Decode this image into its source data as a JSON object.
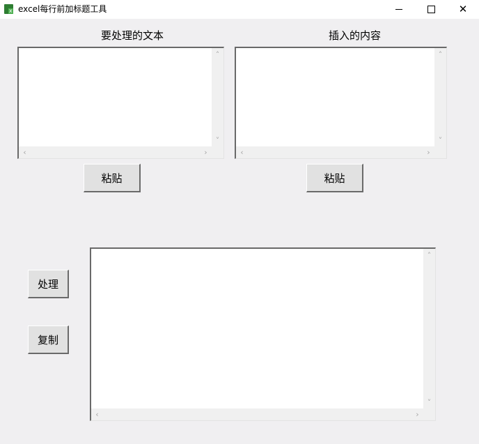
{
  "window": {
    "title": "excel每行前加标题工具",
    "app_icon": "excel-icon",
    "controls": [
      "minimize-icon",
      "maximize-icon",
      "close-icon"
    ]
  },
  "input_panel": {
    "label": "要处理的文本",
    "value": "",
    "paste_label": "粘贴"
  },
  "insert_panel": {
    "label": "插入的内容",
    "value": "",
    "paste_label": "粘贴"
  },
  "actions": {
    "process_label": "处理",
    "copy_label": "复制"
  },
  "output": {
    "value": ""
  }
}
